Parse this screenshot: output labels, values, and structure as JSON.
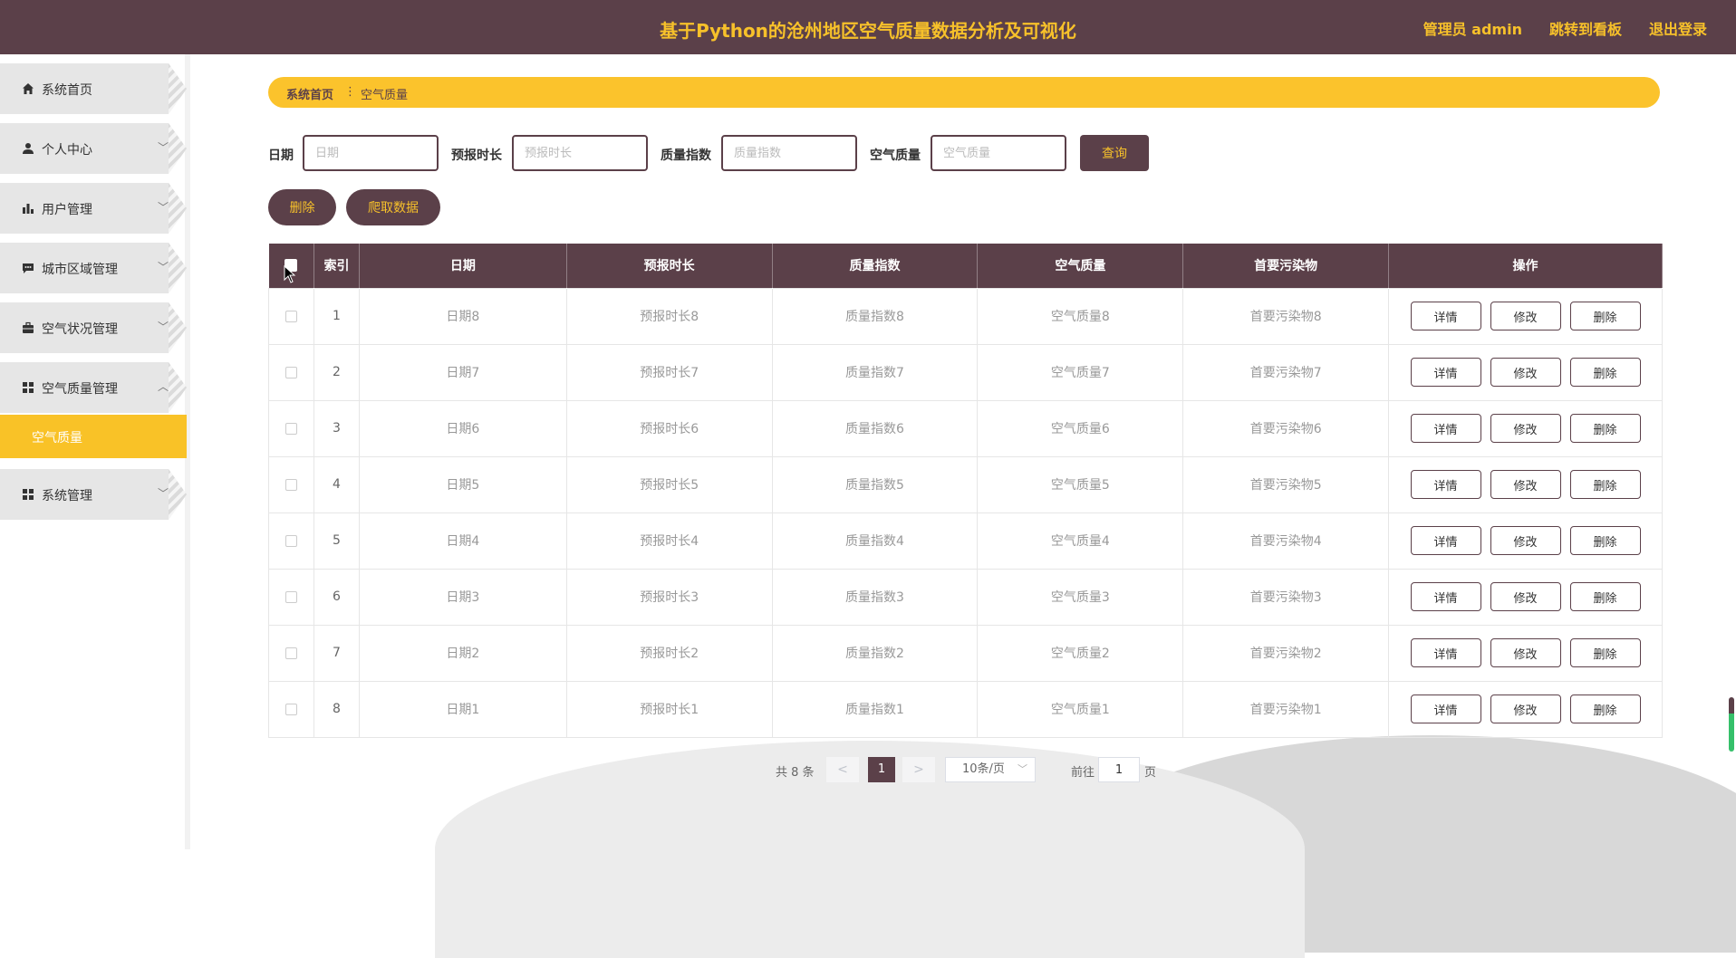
{
  "header": {
    "title": "基于Python的沧州地区空气质量数据分析及可视化",
    "links": [
      "管理员 admin",
      "跳转到看板",
      "退出登录"
    ]
  },
  "sidebar": {
    "items": [
      {
        "label": "系统首页",
        "icon": "home-icon"
      },
      {
        "label": "个人中心",
        "icon": "user-icon"
      },
      {
        "label": "用户管理",
        "icon": "bar-chart-icon"
      },
      {
        "label": "城市区域管理",
        "icon": "message-icon"
      },
      {
        "label": "空气状况管理",
        "icon": "briefcase-icon"
      },
      {
        "label": "空气质量管理",
        "icon": "grid-icon"
      },
      {
        "label": "系统管理",
        "icon": "grid-icon"
      }
    ],
    "active_sub": "空气质量"
  },
  "breadcrumb": {
    "home": "系统首页",
    "separator": "⋮",
    "current": "空气质量"
  },
  "search": {
    "fields": [
      {
        "label": "日期",
        "placeholder": "日期"
      },
      {
        "label": "预报时长",
        "placeholder": "预报时长"
      },
      {
        "label": "质量指数",
        "placeholder": "质量指数"
      },
      {
        "label": "空气质量",
        "placeholder": "空气质量"
      }
    ],
    "query_label": "查询"
  },
  "actions": {
    "delete_label": "删除",
    "crawl_label": "爬取数据"
  },
  "table": {
    "columns": [
      "索引",
      "日期",
      "预报时长",
      "质量指数",
      "空气质量",
      "首要污染物",
      "操作"
    ],
    "rows": [
      [
        "1",
        "日期8",
        "预报时长8",
        "质量指数8",
        "空气质量8",
        "首要污染物8"
      ],
      [
        "2",
        "日期7",
        "预报时长7",
        "质量指数7",
        "空气质量7",
        "首要污染物7"
      ],
      [
        "3",
        "日期6",
        "预报时长6",
        "质量指数6",
        "空气质量6",
        "首要污染物6"
      ],
      [
        "4",
        "日期5",
        "预报时长5",
        "质量指数5",
        "空气质量5",
        "首要污染物5"
      ],
      [
        "5",
        "日期4",
        "预报时长4",
        "质量指数4",
        "空气质量4",
        "首要污染物4"
      ],
      [
        "6",
        "日期3",
        "预报时长3",
        "质量指数3",
        "空气质量3",
        "首要污染物3"
      ],
      [
        "7",
        "日期2",
        "预报时长2",
        "质量指数2",
        "空气质量2",
        "首要污染物2"
      ],
      [
        "8",
        "日期1",
        "预报时长1",
        "质量指数1",
        "空气质量1",
        "首要污染物1"
      ]
    ],
    "row_actions": [
      "详情",
      "修改",
      "删除"
    ]
  },
  "pagination": {
    "total": "共 8 条",
    "prev": "<",
    "next": ">",
    "current": "1",
    "page_size": "10条/页",
    "goto_label": "前往",
    "goto_value": "1",
    "goto_unit": "页"
  },
  "colors": {
    "primary": "#5b4049",
    "accent": "#f7c12a"
  }
}
